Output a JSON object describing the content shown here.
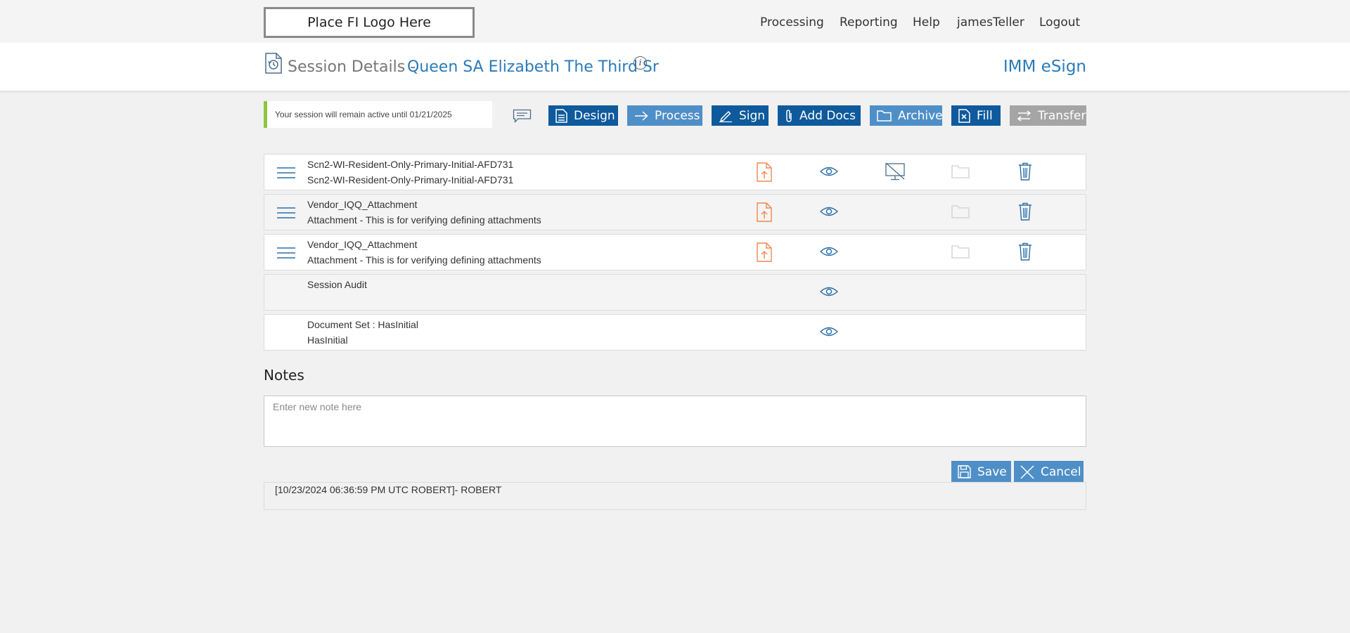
{
  "top_nav": {
    "logo_text": "Place FI Logo Here",
    "items": [
      "Processing",
      "Reporting",
      "Help",
      "jamesTeller",
      "Logout"
    ]
  },
  "header": {
    "title": "Session Details -",
    "client_name": "Queen SA Elizabeth The Third Sr",
    "info_glyph": "i",
    "brand": "IMM eSign"
  },
  "session": {
    "notice": "Your session will remain active until 01/21/2025"
  },
  "toolbar": {
    "buttons": [
      {
        "label": "Design",
        "icon": "design-icon"
      },
      {
        "label": "Process",
        "icon": "arrow-right-icon"
      },
      {
        "label": "Sign",
        "icon": "pen-icon"
      },
      {
        "label": "Add Docs",
        "icon": "paperclip-icon"
      },
      {
        "label": "Archive",
        "icon": "folder-icon"
      },
      {
        "label": "Fill",
        "icon": "fill-icon"
      },
      {
        "label": "Transfer",
        "icon": "transfer-icon"
      }
    ]
  },
  "documents": [
    {
      "line1": "Scn2-WI-Resident-Only-Primary-Initial-AFD731",
      "line2": "Scn2-WI-Resident-Only-Primary-Initial-AFD731",
      "icons": [
        "file-upload-icon",
        "eye-icon",
        "no-display-icon",
        "folder-icon",
        "trash-icon"
      ]
    },
    {
      "line1": "Vendor_IQQ_Attachment",
      "line2": "Attachment - This is for verifying defining attachments",
      "icons": [
        "file-upload-icon",
        "eye-icon",
        "folder-icon",
        "trash-icon"
      ]
    },
    {
      "line1": "Vendor_IQQ_Attachment",
      "line2": "Attachment - This is for verifying defining attachments",
      "icons": [
        "file-upload-icon",
        "eye-icon",
        "folder-icon",
        "trash-icon"
      ]
    },
    {
      "line1": "Session Audit",
      "line2": "",
      "icons": [
        "eye-icon"
      ]
    },
    {
      "line1": "Document Set : HasInitial",
      "line2": "HasInitial",
      "icons": [
        "eye-icon"
      ]
    }
  ],
  "notes": {
    "heading": "Notes",
    "placeholder": "Enter new note here",
    "save_label": "Save",
    "cancel_label": "Cancel",
    "entries": [
      "[10/23/2024 06:36:59 PM UTC ROBERT]- ROBERT"
    ]
  },
  "colors": {
    "accent_blue": "#2b7bb9",
    "button_dark": "#0e5a9c",
    "button_light": "#4f8fc7",
    "button_disabled": "#a5a5a5",
    "session_green": "#8dc63f",
    "upload_orange": "#f0874f"
  }
}
